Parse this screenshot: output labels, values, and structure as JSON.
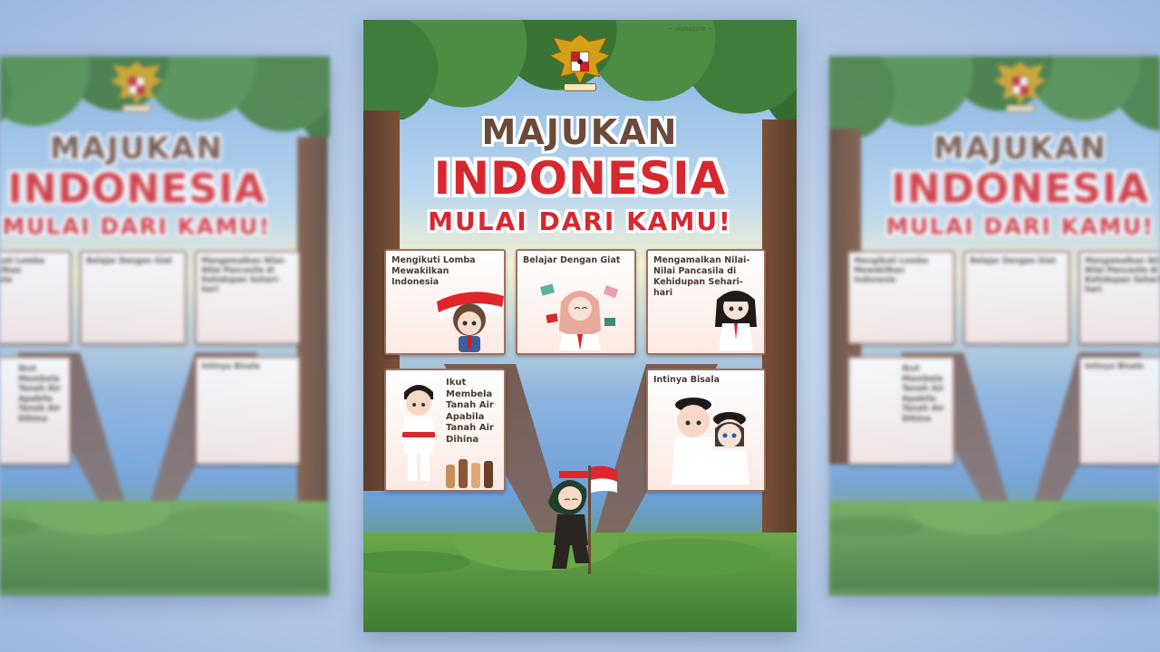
{
  "poster": {
    "title_line1": "MAJUKAN",
    "title_line2": "INDONESIA",
    "title_line3": "MULAI DARI KAMU!",
    "cards": [
      {
        "label": "Mengikuti Lomba Mewakilkan Indonesia"
      },
      {
        "label": "Belajar Dengan Giat"
      },
      {
        "label": "Mengamalkan Nilai-Nilai Pancasila di Kehidupan Sehari-hari"
      },
      {
        "label": "Ikut Membela Tanah Air Apabila Tanah Air Dihina"
      },
      {
        "label": "Intinya Bisala"
      }
    ]
  },
  "colors": {
    "title_red": "#d7282f",
    "title_brown": "#6b4a3c",
    "card_border": "#9c7060",
    "flag_red": "#e0252c",
    "background": "#b9cde9"
  },
  "icons": [
    "garuda-emblem-icon",
    "flag-icon",
    "student-character-icon"
  ]
}
